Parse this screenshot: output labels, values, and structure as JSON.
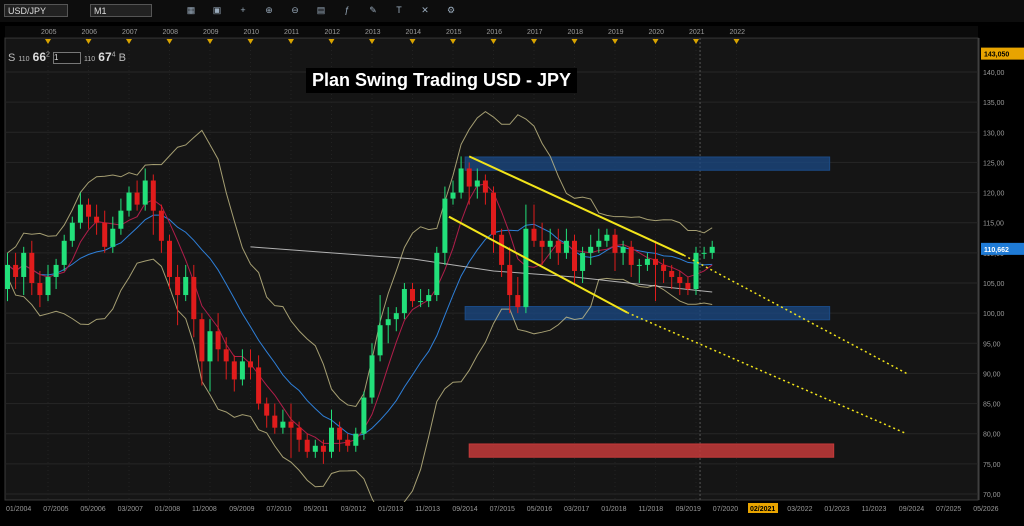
{
  "toolbar": {
    "symbol": "USD/JPY",
    "timeframe": "M1",
    "icons": [
      "chart-type-icon",
      "compare-icon",
      "crosshair-icon",
      "zoom-in-icon",
      "zoom-out-icon",
      "template-icon",
      "indicator-icon",
      "drawing-icon",
      "text-icon",
      "delete-icon",
      "settings-icon"
    ]
  },
  "quote": {
    "sell_label": "S",
    "sell_prefix": "110",
    "sell_big": "66",
    "sell_sup": "2",
    "qty": "1",
    "buy_prefix": "110",
    "buy_big": "67",
    "buy_sup": "4",
    "buy_label": "B"
  },
  "chart_data": {
    "type": "candlestick",
    "title": "Plan Swing Trading USD - JPY",
    "instrument": "USD/JPY",
    "timeframe": "M1",
    "last_price": "110,662",
    "high_marker": "143,050",
    "current_date_label": "02/2021",
    "year_labels": [
      "2005",
      "2006",
      "2007",
      "2008",
      "2009",
      "2010",
      "2011",
      "2012",
      "2013",
      "2014",
      "2015",
      "2016",
      "2017",
      "2018",
      "2019",
      "2020",
      "2021",
      "2022"
    ],
    "date_labels": [
      "01/2004",
      "07/2005",
      "05/2006",
      "03/2007",
      "01/2008",
      "11/2008",
      "09/2009",
      "07/2010",
      "05/2011",
      "03/2012",
      "01/2013",
      "11/2013",
      "09/2014",
      "07/2015",
      "05/2016",
      "03/2017",
      "01/2018",
      "11/2018",
      "09/2019",
      "07/2020",
      "02/2021",
      "03/2022",
      "01/2023",
      "11/2023",
      "09/2024",
      "07/2025",
      "05/2026"
    ],
    "y_ticks": [
      "140,00",
      "135,00",
      "130,00",
      "125,00",
      "120,00",
      "115,00",
      "110,00",
      "105,00",
      "100,00",
      "95,00",
      "90,00",
      "85,00",
      "80,00",
      "75,00",
      "70,00"
    ],
    "ylim": [
      69,
      144.5
    ],
    "colors": {
      "up": "#22e07a",
      "down": "#e01c1c",
      "channel": "#f2e41a",
      "bollinger": "#c9c08a",
      "ma_blue": "#2e7fd8",
      "ma_red": "#b01e4a",
      "ma_white": "#d8d8d8",
      "zone_blue": "#1b4a85",
      "zone_red": "#c43a3a"
    },
    "zones": [
      {
        "name": "resistance",
        "from": 2015.3,
        "to": 2024.3,
        "low": 123.7,
        "high": 125.9,
        "color": "#1b4a85"
      },
      {
        "name": "support",
        "from": 2015.3,
        "to": 2024.3,
        "low": 98.9,
        "high": 101.1,
        "color": "#1b4a85"
      },
      {
        "name": "target",
        "from": 2015.4,
        "to": 2024.4,
        "low": 76.1,
        "high": 78.3,
        "color": "#c43a3a"
      }
    ],
    "channel": {
      "upper": {
        "from": [
          2015.4,
          126.0
        ],
        "to": [
          2020.7,
          109.6
        ],
        "extend_to": [
          2026.2,
          90.0
        ]
      },
      "lower": {
        "from": [
          2014.9,
          116.0
        ],
        "to": [
          2019.3,
          100.1
        ],
        "extend_to": [
          2026.2,
          80.0
        ]
      }
    },
    "candles": [
      [
        2004.0,
        104,
        108,
        102,
        110
      ],
      [
        2004.2,
        108,
        106,
        104,
        110
      ],
      [
        2004.4,
        106,
        110,
        103,
        111
      ],
      [
        2004.6,
        110,
        105,
        103,
        112
      ],
      [
        2004.8,
        105,
        103,
        101,
        107
      ],
      [
        2005.0,
        103,
        106,
        102,
        108
      ],
      [
        2005.2,
        106,
        108,
        104,
        109
      ],
      [
        2005.4,
        108,
        112,
        107,
        113
      ],
      [
        2005.6,
        112,
        115,
        111,
        116
      ],
      [
        2005.8,
        115,
        118,
        114,
        120
      ],
      [
        2006.0,
        118,
        116,
        114,
        119
      ],
      [
        2006.2,
        116,
        115,
        113,
        118
      ],
      [
        2006.4,
        115,
        111,
        110,
        117
      ],
      [
        2006.6,
        111,
        114,
        110,
        116
      ],
      [
        2006.8,
        114,
        117,
        113,
        119
      ],
      [
        2007.0,
        117,
        120,
        116,
        121
      ],
      [
        2007.2,
        120,
        118,
        117,
        122
      ],
      [
        2007.4,
        118,
        122,
        117,
        124
      ],
      [
        2007.6,
        122,
        117,
        113,
        123
      ],
      [
        2007.8,
        117,
        112,
        110,
        118
      ],
      [
        2008.0,
        112,
        106,
        104,
        113
      ],
      [
        2008.2,
        106,
        103,
        98,
        108
      ],
      [
        2008.4,
        103,
        106,
        102,
        108
      ],
      [
        2008.6,
        106,
        99,
        96,
        108
      ],
      [
        2008.8,
        99,
        92,
        88,
        100
      ],
      [
        2009.0,
        92,
        97,
        87,
        99
      ],
      [
        2009.2,
        97,
        94,
        92,
        100
      ],
      [
        2009.4,
        94,
        92,
        89,
        96
      ],
      [
        2009.6,
        92,
        89,
        87,
        93
      ],
      [
        2009.8,
        89,
        92,
        88,
        94
      ],
      [
        2010.0,
        92,
        91,
        89,
        94
      ],
      [
        2010.2,
        91,
        85,
        84,
        93
      ],
      [
        2010.4,
        85,
        83,
        81,
        86
      ],
      [
        2010.6,
        83,
        81,
        80,
        85
      ],
      [
        2010.8,
        81,
        82,
        80,
        84
      ],
      [
        2011.0,
        82,
        81,
        76,
        85
      ],
      [
        2011.2,
        81,
        79,
        77,
        82
      ],
      [
        2011.4,
        79,
        77,
        76,
        80
      ],
      [
        2011.6,
        77,
        78,
        76,
        79
      ],
      [
        2011.8,
        78,
        77,
        75,
        79
      ],
      [
        2012.0,
        77,
        81,
        76,
        84
      ],
      [
        2012.2,
        81,
        79,
        77,
        82
      ],
      [
        2012.4,
        79,
        78,
        77,
        80
      ],
      [
        2012.6,
        78,
        80,
        77,
        81
      ],
      [
        2012.8,
        80,
        86,
        79,
        87
      ],
      [
        2013.0,
        86,
        93,
        85,
        95
      ],
      [
        2013.2,
        93,
        98,
        92,
        103
      ],
      [
        2013.4,
        98,
        99,
        95,
        101
      ],
      [
        2013.6,
        99,
        100,
        97,
        101
      ],
      [
        2013.8,
        100,
        104,
        99,
        105
      ],
      [
        2014.0,
        104,
        102,
        101,
        105
      ],
      [
        2014.2,
        102,
        102,
        101,
        104
      ],
      [
        2014.4,
        102,
        103,
        101,
        104
      ],
      [
        2014.6,
        103,
        110,
        102,
        111
      ],
      [
        2014.8,
        110,
        119,
        108,
        121
      ],
      [
        2015.0,
        119,
        120,
        118,
        122
      ],
      [
        2015.2,
        120,
        124,
        119,
        126
      ],
      [
        2015.4,
        124,
        121,
        118,
        125
      ],
      [
        2015.6,
        121,
        122,
        119,
        124
      ],
      [
        2015.8,
        122,
        120,
        118,
        123
      ],
      [
        2016.0,
        120,
        113,
        110,
        121
      ],
      [
        2016.2,
        113,
        108,
        106,
        114
      ],
      [
        2016.4,
        108,
        103,
        100,
        111
      ],
      [
        2016.6,
        103,
        101,
        100,
        106
      ],
      [
        2016.8,
        101,
        114,
        100,
        118
      ],
      [
        2017.0,
        114,
        112,
        111,
        118
      ],
      [
        2017.2,
        112,
        111,
        108,
        115
      ],
      [
        2017.4,
        111,
        112,
        109,
        114
      ],
      [
        2017.6,
        112,
        110,
        108,
        114
      ],
      [
        2017.8,
        110,
        112,
        109,
        114
      ],
      [
        2018.0,
        112,
        107,
        105,
        113
      ],
      [
        2018.2,
        107,
        110,
        105,
        111
      ],
      [
        2018.4,
        110,
        111,
        108,
        113
      ],
      [
        2018.6,
        111,
        112,
        110,
        114
      ],
      [
        2018.8,
        112,
        113,
        111,
        114
      ],
      [
        2019.0,
        113,
        110,
        107,
        114
      ],
      [
        2019.2,
        110,
        111,
        108,
        112
      ],
      [
        2019.4,
        111,
        108,
        106,
        112
      ],
      [
        2019.6,
        108,
        108,
        105,
        109
      ],
      [
        2019.8,
        108,
        109,
        107,
        110
      ],
      [
        2020.0,
        109,
        108,
        102,
        112
      ],
      [
        2020.2,
        108,
        107,
        105,
        109
      ],
      [
        2020.4,
        107,
        106,
        104,
        108
      ],
      [
        2020.6,
        106,
        105,
        103,
        107
      ],
      [
        2020.8,
        105,
        104,
        103,
        106
      ],
      [
        2021.0,
        104,
        110,
        103,
        111
      ],
      [
        2021.2,
        110,
        110,
        109,
        111
      ],
      [
        2021.4,
        110,
        111,
        109,
        112
      ]
    ]
  }
}
